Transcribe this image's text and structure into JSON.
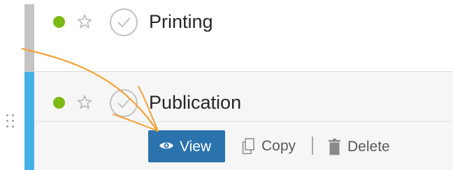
{
  "rows": [
    {
      "title": "Printing",
      "status_color": "#7db815",
      "accent_color": "#c4c4c4",
      "icons": [
        "status-dot",
        "star-outline-icon",
        "check-circle-icon"
      ]
    },
    {
      "title": "Publication",
      "status_color": "#7db815",
      "accent_color": "#45b1e4",
      "icons": [
        "drag-handle-icon",
        "status-dot",
        "star-outline-icon",
        "check-circle-icon"
      ],
      "actions": {
        "view_label": "View",
        "view_icon": "eye-icon",
        "copy_label": "Copy",
        "copy_icon": "copy-icon",
        "delete_label": "Delete",
        "delete_icon": "trash-icon",
        "view_button_color": "#2a73ad"
      }
    }
  ],
  "annotation": {
    "arrow_color": "#f3a33a",
    "icon": "curved-arrow-annotation"
  }
}
